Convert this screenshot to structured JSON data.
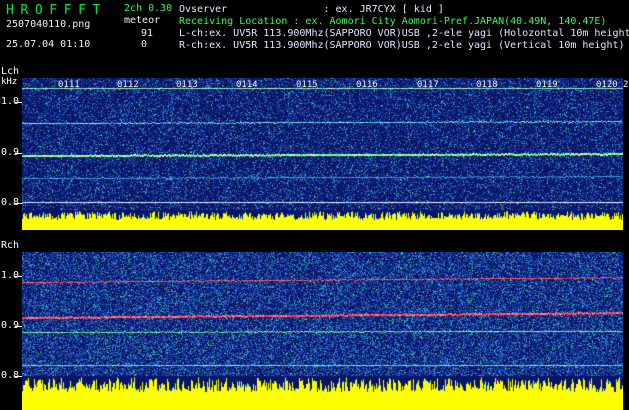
{
  "app": {
    "title": "HROFFFT",
    "mode": "2ch 0.30",
    "filename": "2507040110.png",
    "event_label": "meteor",
    "datetime": "25.07.04 01:10",
    "count_lch": "91",
    "count_rch": "0"
  },
  "header": {
    "observer": "Ovserver                : ex. JR7CYX [ kid ]",
    "location": "Receiving Location : ex. Aomori City Aomori-Pref.JAPAN(40.49N, 140.47E)",
    "lch": "L-ch:ex. UV5R 113.900Mhz(SAPPORO VOR)USB ,2-ele yagi (Holozontal 10m height",
    "rch": "R-ch:ex. UV5R 113.900Mhz(SAPPORO VOR)USB ,2-ele yagi (Vertical 10m height)"
  },
  "time_ticks": [
    "0111",
    "0112",
    "0113",
    "0114",
    "0115",
    "0116",
    "0117",
    "0118",
    "0119",
    "0120",
    "2"
  ],
  "lch_panel": {
    "label": "Lch",
    "unit": "kHz",
    "freq_labels": [
      "1.0",
      "0.9",
      "0.8"
    ]
  },
  "rch_panel": {
    "label": "Rch",
    "freq_labels": [
      "1.0",
      "0.9",
      "0.8"
    ]
  },
  "colors": {
    "waterfall_bg": "#0a1a6e",
    "yellow_bar": "#ffff00",
    "green_text": "#00e84a",
    "red_line": "#ff3040"
  }
}
